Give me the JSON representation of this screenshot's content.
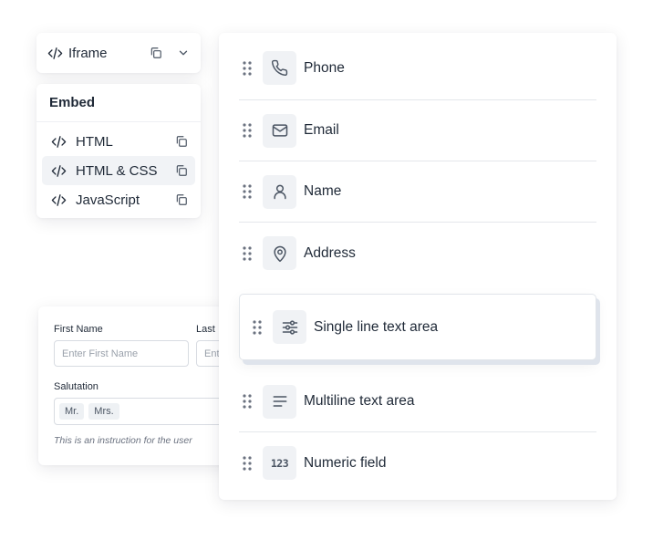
{
  "iframe_bar": {
    "label": "Iframe",
    "code_icon": "code-brackets-icon",
    "copy_icon": "copy-icon",
    "expand_icon": "chevron-down-icon"
  },
  "embed_menu": {
    "title": "Embed",
    "items": [
      {
        "label": "HTML",
        "active": false
      },
      {
        "label": "HTML & CSS",
        "active": true
      },
      {
        "label": "JavaScript",
        "active": false
      }
    ]
  },
  "form_preview": {
    "first_name_label": "First Name",
    "first_name_placeholder": "Enter First Name",
    "last_name_label": "Last",
    "last_name_placeholder": "Ent",
    "salutation_label": "Salutation",
    "salutation_options": [
      "Mr.",
      "Mrs."
    ],
    "instruction": "This is an instruction for  the user"
  },
  "fields": [
    {
      "label": "Phone",
      "icon": "phone-icon"
    },
    {
      "label": "Email",
      "icon": "mail-icon"
    },
    {
      "label": "Name",
      "icon": "user-icon"
    },
    {
      "label": "Address",
      "icon": "map-pin-icon"
    },
    {
      "label": "Single line text area",
      "icon": "sliders-icon",
      "dragging": true
    },
    {
      "label": "Multiline text area",
      "icon": "text-lines-icon"
    },
    {
      "label": "Numeric field",
      "icon": "numeric-icon",
      "glyph": "123"
    }
  ],
  "colors": {
    "text": "#1f2937",
    "icon": "#4b5563",
    "muted": "#9aa1ab",
    "icon_bg": "#f0f2f5",
    "active_bg": "#f1f3f6",
    "border": "#e4e7eb"
  }
}
